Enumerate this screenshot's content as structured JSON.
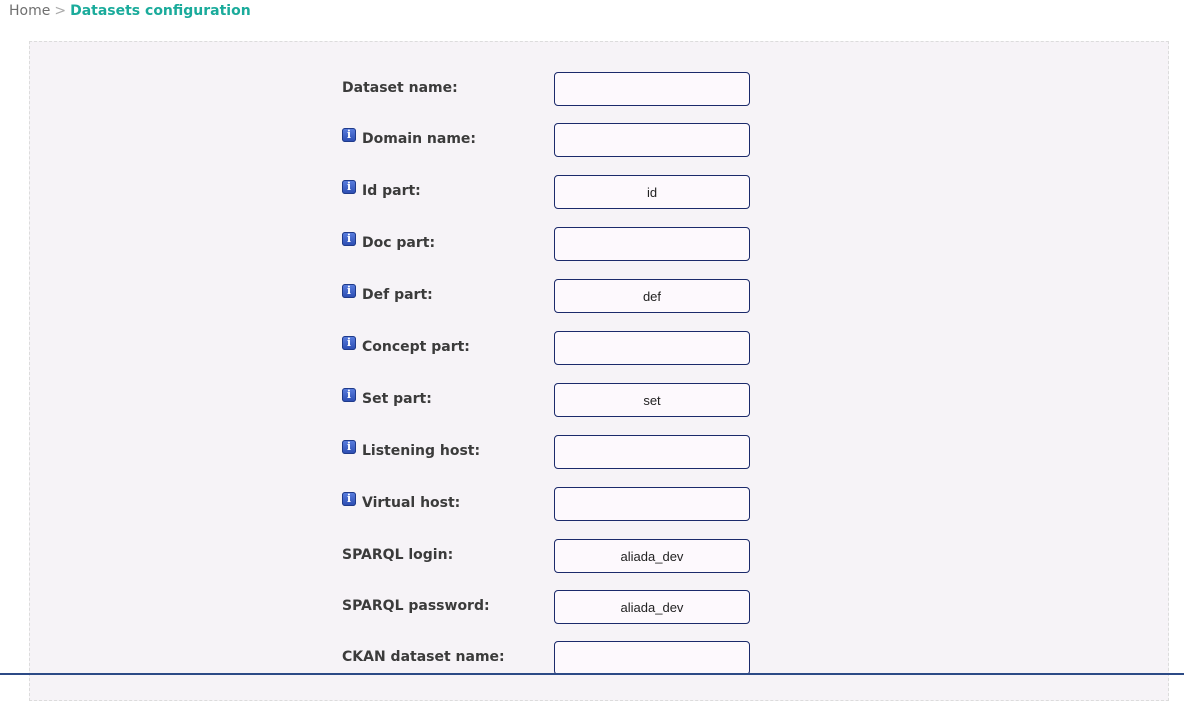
{
  "breadcrumb": {
    "home": "Home",
    "separator": ">",
    "current": "Datasets configuration"
  },
  "form": {
    "fields": [
      {
        "label": "Dataset name:",
        "value": "",
        "info": false
      },
      {
        "label": "Domain name:",
        "value": "",
        "info": true
      },
      {
        "label": "Id part:",
        "value": "id",
        "info": true
      },
      {
        "label": "Doc part:",
        "value": "",
        "info": true
      },
      {
        "label": "Def part:",
        "value": "def",
        "info": true
      },
      {
        "label": "Concept part:",
        "value": "",
        "info": true
      },
      {
        "label": "Set part:",
        "value": "set",
        "info": true
      },
      {
        "label": "Listening host:",
        "value": "",
        "info": true
      },
      {
        "label": "Virtual host:",
        "value": "",
        "info": true
      },
      {
        "label": "SPARQL login:",
        "value": "aliada_dev",
        "info": false
      },
      {
        "label": "SPARQL password:",
        "value": "aliada_dev",
        "info": false
      },
      {
        "label": "CKAN dataset name:",
        "value": "",
        "info": false
      }
    ]
  },
  "icons": {
    "info": "info-icon"
  },
  "colors": {
    "breadcrumb_current": "#1aab9b",
    "field_border": "#1b2a6b",
    "panel_background": "#f6f3f7",
    "info_icon": "#2a4bb0"
  }
}
